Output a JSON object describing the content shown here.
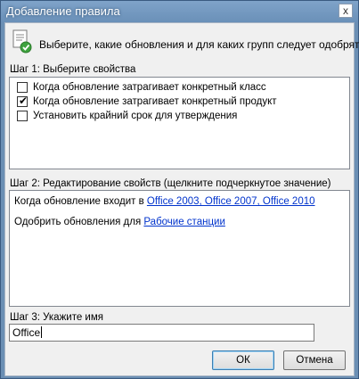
{
  "window": {
    "title": "Добавление правила",
    "close_glyph": "x"
  },
  "header": {
    "instruction": "Выберите, какие обновления и для каких групп следует одобрять.",
    "icon": "rule-document-check-icon"
  },
  "step1": {
    "label": "Шаг 1: Выберите свойства",
    "items": [
      {
        "label": "Когда обновление затрагивает конкретный класс",
        "checked": false
      },
      {
        "label": "Когда обновление затрагивает конкретный продукт",
        "checked": true
      },
      {
        "label": "Установить крайний срок для утверждения",
        "checked": false
      }
    ]
  },
  "step2": {
    "label": "Шаг 2: Редактирование свойств (щелкните подчеркнутое значение)",
    "line1_prefix": "Когда обновление входит в ",
    "line1_link": "Office 2003, Office 2007, Office 2010",
    "line2_prefix": "Одобрить обновления для ",
    "line2_link": "Рабочие станции"
  },
  "step3": {
    "label": "Шаг 3: Укажите имя",
    "name_value": "Office"
  },
  "buttons": {
    "ok_label": "ОК",
    "cancel_label": "Отмена"
  },
  "colors": {
    "title_bar": "#6a90b8",
    "link": "#0033cc"
  }
}
